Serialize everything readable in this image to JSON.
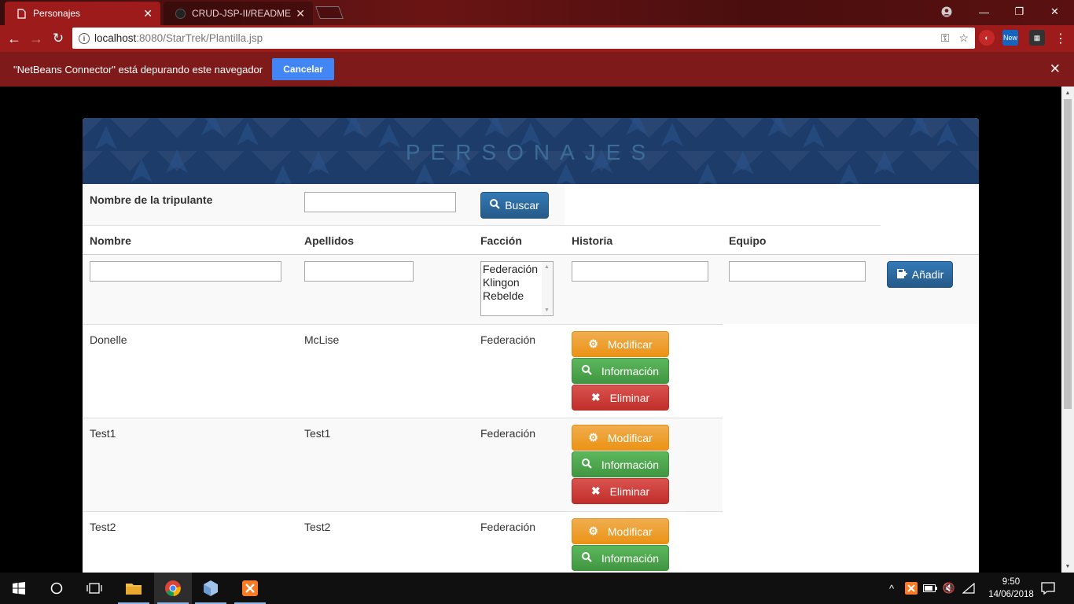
{
  "browser": {
    "tabs": [
      {
        "title": "Personajes",
        "icon": "page-icon",
        "active": true
      },
      {
        "title": "CRUD-JSP-II/README.md",
        "icon": "github-icon",
        "active": false
      }
    ],
    "url_host": "localhost",
    "url_rest": ":8080/StarTrek/Plantilla.jsp",
    "extensions": [
      "shield-extension",
      "new-extension",
      "color-extension"
    ],
    "new_badge": "New"
  },
  "infobar": {
    "message": "\"NetBeans Connector\" está depurando este navegador",
    "cancel_label": "Cancelar"
  },
  "page": {
    "banner_title": "PERSONAJES",
    "search": {
      "label": "Nombre de la tripulante",
      "button_label": "Buscar",
      "value": ""
    },
    "columns": [
      "Nombre",
      "Apellidos",
      "Facción",
      "Historia",
      "Equipo"
    ],
    "faction_options": [
      "Federación",
      "Klingon",
      "Rebelde"
    ],
    "add_button_label": "Añadir",
    "action_labels": {
      "modify": "Modificar",
      "info": "Información",
      "delete": "Eliminar"
    },
    "rows": [
      {
        "nombre": "Donelle",
        "apellidos": "McLise",
        "faccion": "Federación"
      },
      {
        "nombre": "Test1",
        "apellidos": "Test1",
        "faccion": "Federación"
      },
      {
        "nombre": "Test2",
        "apellidos": "Test2",
        "faccion": "Federación"
      }
    ]
  },
  "taskbar": {
    "time": "9:50",
    "date": "14/06/2018"
  }
}
